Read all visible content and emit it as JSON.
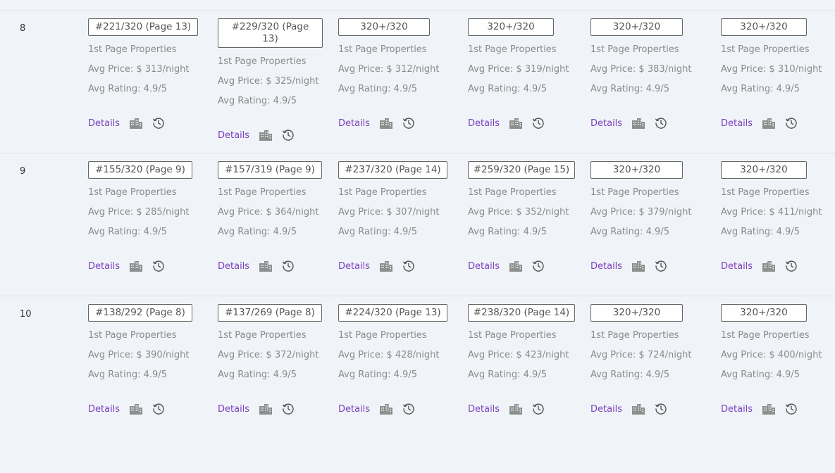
{
  "colors": {
    "accent": "#7b3fbf",
    "muted": "#8a8a8a",
    "background": "#f0f4f8"
  },
  "icons": {
    "building": "building-icon",
    "history": "history-clock-icon"
  },
  "rows": [
    {
      "number": "8",
      "cells": [
        {
          "rank": "#221/320 (Page 13)",
          "props": "1st Page Properties",
          "price": "Avg Price: $ 313/night",
          "rating": "Avg Rating: 4.9/5",
          "details": "Details"
        },
        {
          "rank": "#229/320 (Page 13)",
          "props": "1st Page Properties",
          "price": "Avg Price: $ 325/night",
          "rating": "Avg Rating: 4.9/5",
          "details": "Details"
        },
        {
          "rank": "320+/320",
          "props": "1st Page Properties",
          "price": "Avg Price: $ 312/night",
          "rating": "Avg Rating: 4.9/5",
          "details": "Details"
        },
        {
          "rank": "320+/320",
          "props": "1st Page Properties",
          "price": "Avg Price: $ 319/night",
          "rating": "Avg Rating: 4.9/5",
          "details": "Details"
        },
        {
          "rank": "320+/320",
          "props": "1st Page Properties",
          "price": "Avg Price: $ 383/night",
          "rating": "Avg Rating: 4.9/5",
          "details": "Details"
        },
        {
          "rank": "320+/320",
          "props": "1st Page Properties",
          "price": "Avg Price: $ 310/night",
          "rating": "Avg Rating: 4.9/5",
          "details": "Details"
        }
      ]
    },
    {
      "number": "9",
      "cells": [
        {
          "rank": "#155/320 (Page 9)",
          "props": "1st Page Properties",
          "price": "Avg Price: $ 285/night",
          "rating": "Avg Rating: 4.9/5",
          "details": "Details"
        },
        {
          "rank": "#157/319 (Page 9)",
          "props": "1st Page Properties",
          "price": "Avg Price: $ 364/night",
          "rating": "Avg Rating: 4.9/5",
          "details": "Details"
        },
        {
          "rank": "#237/320 (Page 14)",
          "props": "1st Page Properties",
          "price": "Avg Price: $ 307/night",
          "rating": "Avg Rating: 4.9/5",
          "details": "Details"
        },
        {
          "rank": "#259/320 (Page 15)",
          "props": "1st Page Properties",
          "price": "Avg Price: $ 352/night",
          "rating": "Avg Rating: 4.9/5",
          "details": "Details"
        },
        {
          "rank": "320+/320",
          "props": "1st Page Properties",
          "price": "Avg Price: $ 379/night",
          "rating": "Avg Rating: 4.9/5",
          "details": "Details"
        },
        {
          "rank": "320+/320",
          "props": "1st Page Properties",
          "price": "Avg Price: $ 411/night",
          "rating": "Avg Rating: 4.9/5",
          "details": "Details"
        }
      ]
    },
    {
      "number": "10",
      "cells": [
        {
          "rank": "#138/292 (Page 8)",
          "props": "1st Page Properties",
          "price": "Avg Price: $ 390/night",
          "rating": "Avg Rating: 4.9/5",
          "details": "Details"
        },
        {
          "rank": "#137/269 (Page 8)",
          "props": "1st Page Properties",
          "price": "Avg Price: $ 372/night",
          "rating": "Avg Rating: 4.9/5",
          "details": "Details"
        },
        {
          "rank": "#224/320 (Page 13)",
          "props": "1st Page Properties",
          "price": "Avg Price: $ 428/night",
          "rating": "Avg Rating: 4.9/5",
          "details": "Details"
        },
        {
          "rank": "#238/320 (Page 14)",
          "props": "1st Page Properties",
          "price": "Avg Price: $ 423/night",
          "rating": "Avg Rating: 4.9/5",
          "details": "Details"
        },
        {
          "rank": "320+/320",
          "props": "1st Page Properties",
          "price": "Avg Price: $ 724/night",
          "rating": "Avg Rating: 4.9/5",
          "details": "Details"
        },
        {
          "rank": "320+/320",
          "props": "1st Page Properties",
          "price": "Avg Price: $ 400/night",
          "rating": "Avg Rating: 4.9/5",
          "details": "Details"
        }
      ]
    }
  ]
}
